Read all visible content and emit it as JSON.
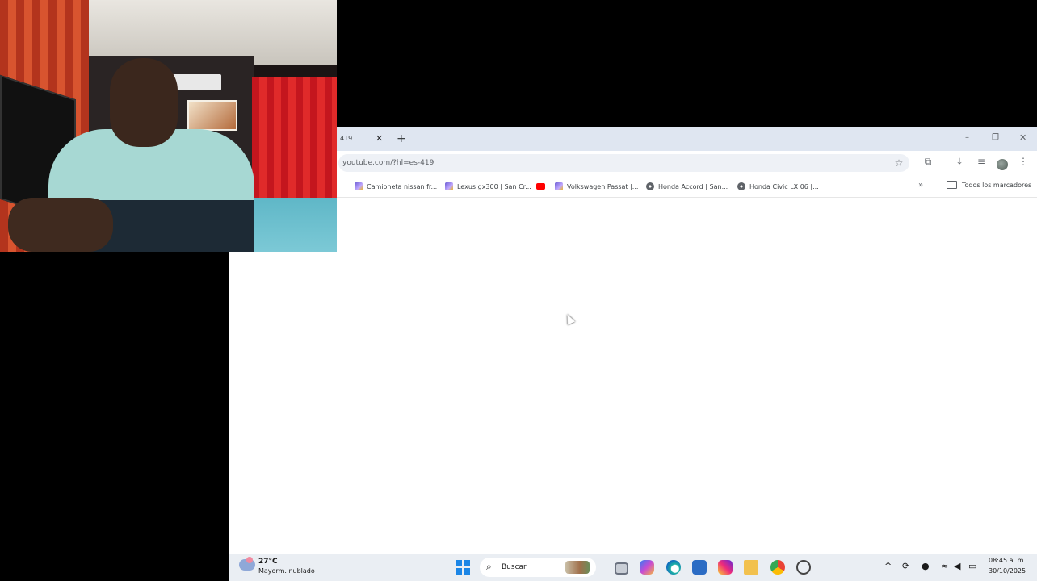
{
  "browser": {
    "tab": {
      "title": "419",
      "close": "✕"
    },
    "new_tab": "+",
    "window_controls": {
      "minimize": "–",
      "maximize": "❐",
      "close": "✕"
    },
    "address": "youtube.com/?hl=es-419",
    "toolbar_icons": [
      "star-icon",
      "extensions-icon",
      "download-icon",
      "media-icon",
      "profile-icon",
      "menu-icon"
    ],
    "bookmarks": [
      {
        "label": "Camioneta nissan fr...",
        "icon": "generic"
      },
      {
        "label": "Lexus gx300 | San Cr...",
        "icon": "generic"
      },
      {
        "label": "",
        "icon": "youtube"
      },
      {
        "label": "Volkswagen Passat |...",
        "icon": "generic"
      },
      {
        "label": "Honda Accord | San...",
        "icon": "globe"
      },
      {
        "label": "Honda Civic LX 06 |...",
        "icon": "globe"
      }
    ],
    "bookmarks_more": "»",
    "bookmarks_folder": "Todos los marcadores"
  },
  "taskbar": {
    "weather": {
      "temp": "27°C",
      "desc": "Mayorm. nublado"
    },
    "search": {
      "placeholder": "Buscar"
    },
    "clock": {
      "time": "08:45 a. m.",
      "date": "30/10/2025"
    }
  }
}
